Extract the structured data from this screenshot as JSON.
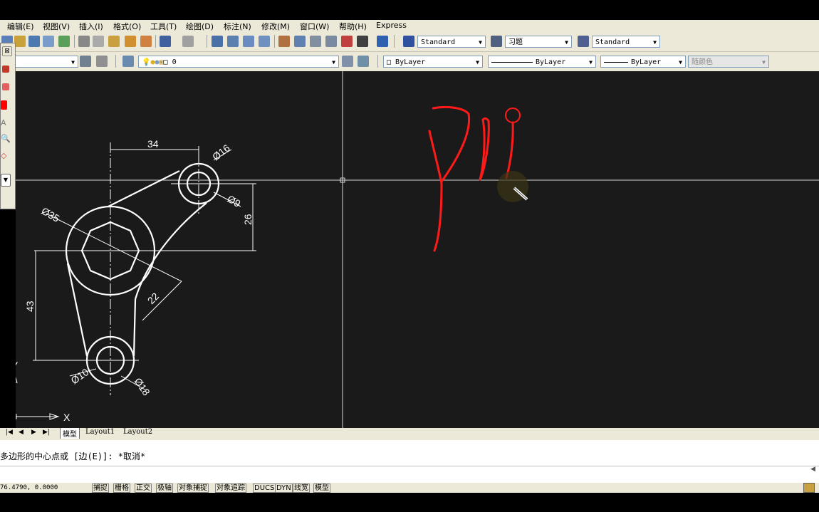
{
  "menu": [
    "编辑(E)",
    "视图(V)",
    "插入(I)",
    "格式(O)",
    "工具(T)",
    "绘图(D)",
    "标注(N)",
    "修改(M)",
    "窗口(W)",
    "帮助(H)",
    "Express"
  ],
  "styles": {
    "text_style": "Standard",
    "dim_style": "习题",
    "table_style": "Standard"
  },
  "layer": {
    "current": "0"
  },
  "properties": {
    "color": "ByLayer",
    "linetype": "ByLayer",
    "lineweight": "ByLayer",
    "plot_style": "随颜色"
  },
  "drawing": {
    "dims": {
      "d34": "34",
      "d16": "Ø16",
      "d9": "Ø9",
      "d26": "26",
      "d35": "Ø35",
      "d22": "22",
      "d43": "43",
      "d10": "Ø10",
      "d18": "Ø18"
    },
    "ucs": {
      "x": "X",
      "y": "Y"
    },
    "colors": {
      "background": "#1a1a1a",
      "geometry": "#ffffff",
      "annotation": "#ff1a1a"
    }
  },
  "tabs": [
    "模型",
    "Layout1",
    "Layout2"
  ],
  "command": {
    "line": "多边形的中心点或 [边(E)]: *取消*"
  },
  "status": {
    "coords": "76.4790, 0.0000",
    "toggles": [
      "捕捉",
      "栅格",
      "正交",
      "极轴",
      "对象捕捉",
      "对象追踪",
      "DUCS",
      "DYN",
      "线宽",
      "模型"
    ]
  }
}
